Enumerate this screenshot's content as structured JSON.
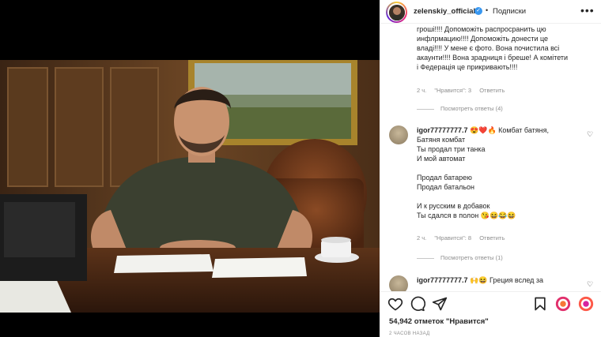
{
  "post": {
    "username": "zelenskiy_official",
    "verified_mark": "✓",
    "separator": "•",
    "follow_label": "Подписки",
    "more_label": "•••"
  },
  "comments": [
    {
      "lines": [
        "гроші!!!! Допоможіть распросранить цю",
        "инфлрмацию!!!! Допоможіть донести це",
        "владі!!!! У мене є фото. Вона почистила всі",
        "акаунти!!!! Вона зрадниця і бреше! А комітети",
        "і Федерація це прикривають!!!!"
      ],
      "time": "2 ч.",
      "likes": "\"Нравится\": 3",
      "reply": "Ответить",
      "view_replies": "Посмотреть ответы (4)"
    },
    {
      "user": "igor77777777.7",
      "first_line": " 😍❤️🔥 Комбат батяня,",
      "lines": [
        "Батяня комбат",
        "Ты продал три танка",
        "И мой автомат",
        "",
        "Продал батарею",
        "Продал батальон",
        "",
        "И к русским в добавок",
        "Ты сдался в полон 😘😆😂😆"
      ],
      "time": "2 ч.",
      "likes": "\"Нравится\": 8",
      "reply": "Ответить",
      "view_replies": "Посмотреть ответы (1)"
    },
    {
      "user": "igor77777777.7",
      "first_line": " 🙌😆 Греция вслед за"
    }
  ],
  "icons": {
    "heart": "heart-icon",
    "comment": "comment-icon",
    "share": "share-icon",
    "save": "bookmark-icon"
  },
  "footer": {
    "likes": "54,942 отметок \"Нравится\"",
    "time": "2 ЧАСОВ НАЗАД"
  },
  "colors": {
    "verified": "#3897f0",
    "text": "#262626",
    "muted": "#8e8e8e"
  }
}
